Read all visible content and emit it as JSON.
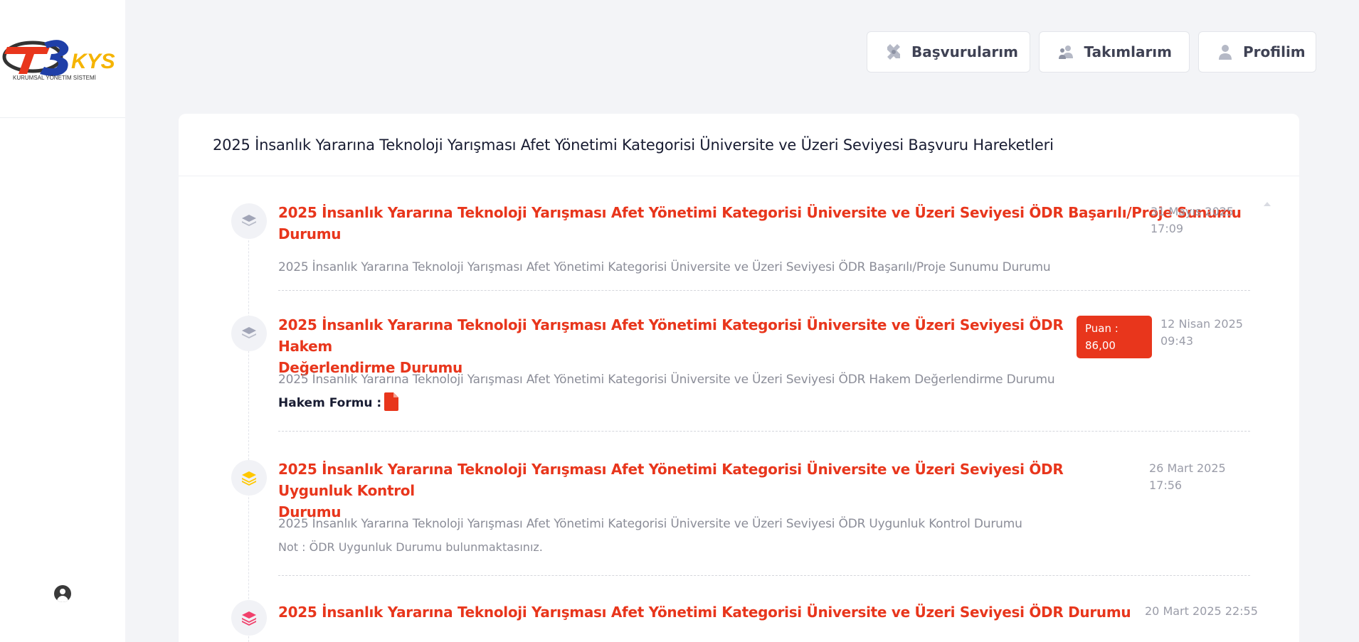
{
  "app": {
    "logo_text": "T3KYS",
    "logo_subtitle": "KURUMSAL YÖNETİM SİSTEMİ"
  },
  "topnav": {
    "applications_label": "Başvurularım",
    "teams_label": "Takımlarım",
    "profile_label": "Profilim"
  },
  "card": {
    "title": "2025 İnsanlık Yararına Teknoloji Yarışması Afet Yönetimi Kategorisi Üniversite ve Üzeri Seviyesi Başvuru Hareketleri"
  },
  "timeline": [
    {
      "title_line1": "2025 İnsanlık Yararına Teknoloji Yarışması Afet Yönetimi Kategorisi Üniversite ve Üzeri Seviyesi ÖDR Başarılı/Proje Sunumu",
      "title_line2": "Durumu",
      "date_line1": "31 Mayıs 2025",
      "date_line2": "17:09",
      "description": "2025 İnsanlık Yararına Teknoloji Yarışması Afet Yönetimi Kategorisi Üniversite ve Üzeri Seviyesi ÖDR Başarılı/Proje Sunumu Durumu",
      "icon": "layers-icon",
      "icon_color": "#a1a5b7"
    },
    {
      "title_line1": "2025 İnsanlık Yararına Teknoloji Yarışması Afet Yönetimi Kategorisi Üniversite ve Üzeri Seviyesi ÖDR Hakem",
      "title_line2": "Değerlendirme Durumu",
      "date_line1": "12 Nisan 2025",
      "date_line2": "09:43",
      "score_label": "Puan :",
      "score_value": "86,00",
      "description": "2025 İnsanlık Yararına Teknoloji Yarışması Afet Yönetimi Kategorisi Üniversite ve Üzeri Seviyesi ÖDR Hakem Değerlendirme Durumu",
      "form_label": "Hakem Formu :",
      "icon": "layers-icon",
      "icon_color": "#a1a5b7"
    },
    {
      "title_line1": "2025 İnsanlık Yararına Teknoloji Yarışması Afet Yönetimi Kategorisi Üniversite ve Üzeri Seviyesi ÖDR Uygunluk Kontrol",
      "title_line2": "Durumu",
      "date_line1": "26 Mart 2025",
      "date_line2": "17:56",
      "description": "2025 İnsanlık Yararına Teknoloji Yarışması Afet Yönetimi Kategorisi Üniversite ve Üzeri Seviyesi ÖDR Uygunluk Kontrol Durumu",
      "note": "Not : ÖDR Uygunluk Durumu bulunmaktasınız.",
      "icon": "layers-icon",
      "icon_color": "#ffc700"
    },
    {
      "title_line1": "2025 İnsanlık Yararına Teknoloji Yarışması Afet Yönetimi Kategorisi Üniversite ve Üzeri Seviyesi ÖDR Durumu",
      "date_line1": "20 Mart 2025 22:55",
      "icon": "layers-icon",
      "icon_color": "#f1416c"
    }
  ],
  "colors": {
    "accent": "#e8361c",
    "muted_text": "#8b8d98",
    "background": "#f3f4f7"
  }
}
